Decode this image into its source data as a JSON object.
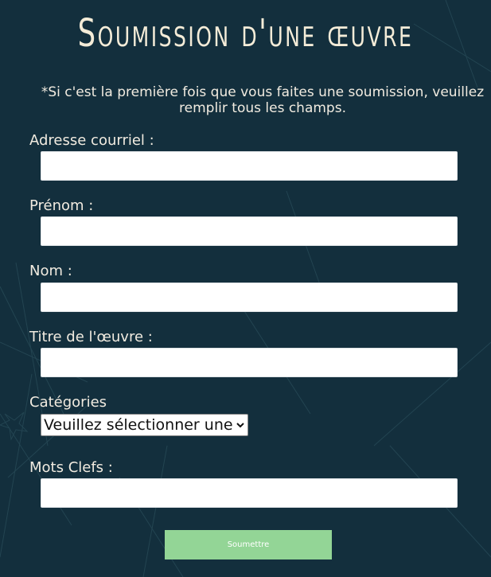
{
  "form": {
    "title": "Soumission d'une œuvre",
    "note": "*Si c'est la première fois que vous faites une soumission, veuillez remplir tous les champs.",
    "fields": {
      "email": {
        "label": "Adresse courriel :",
        "value": ""
      },
      "firstname": {
        "label": "Prénom :",
        "value": ""
      },
      "lastname": {
        "label": "Nom :",
        "value": ""
      },
      "work_title": {
        "label": "Titre de l'œuvre :",
        "value": ""
      },
      "categories": {
        "label": "Catégories",
        "selected": "Veuillez sélectionner une catégorie"
      },
      "keywords": {
        "label": "Mots Clefs :",
        "value": ""
      }
    },
    "submit_label": "Soumettre"
  },
  "colors": {
    "background": "#132f3d",
    "text": "#f1ebe0",
    "submit": "#93d596",
    "field": "#ffffff"
  },
  "icons": {
    "select_arrow": "chevron-down-icon"
  }
}
